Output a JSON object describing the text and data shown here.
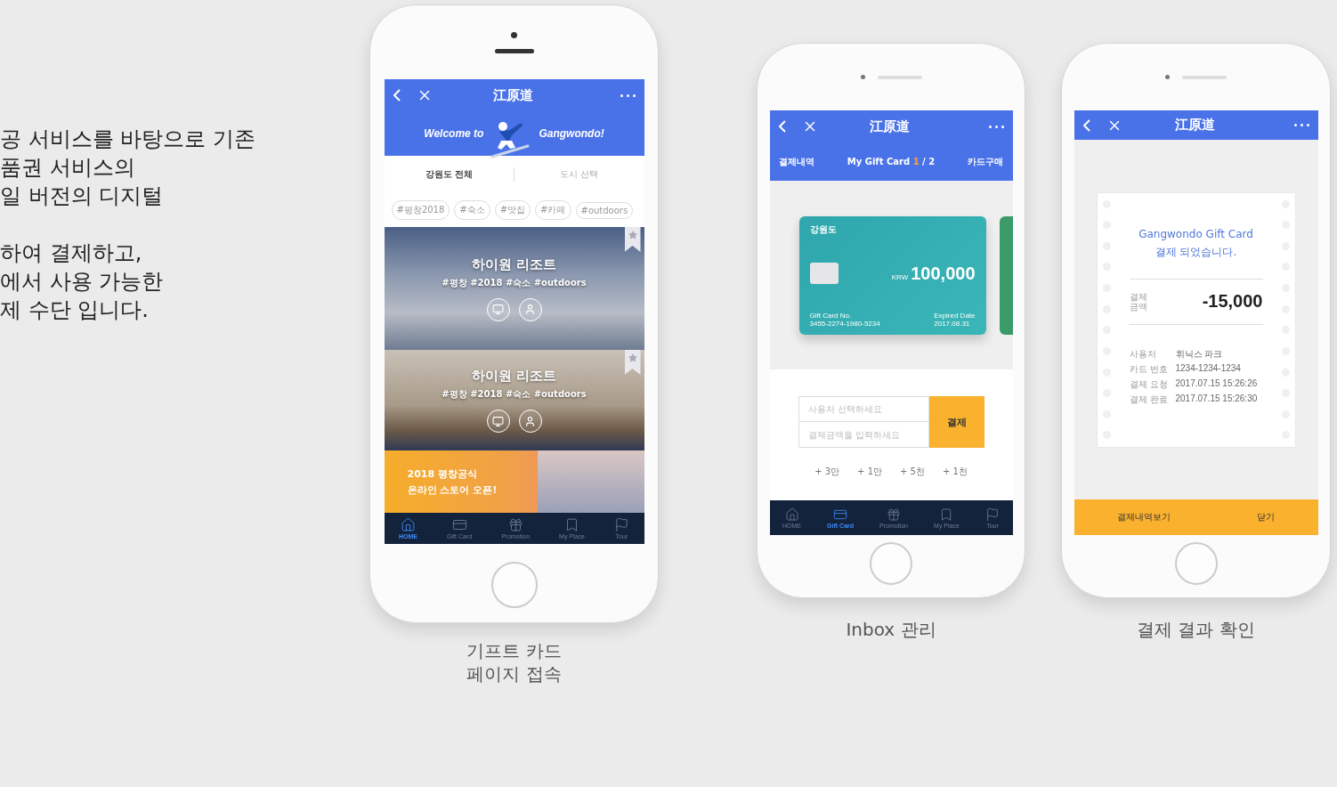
{
  "intro": {
    "paragraphs": [
      [
        "공 서비스를 바탕으로 기존",
        "품권 서비스의",
        "일 버전의 디지털"
      ],
      [
        "하여 결제하고,",
        "에서 사용 가능한",
        "제 수단 입니다."
      ]
    ]
  },
  "home_phone": {
    "title": "江原道",
    "welcome": [
      "Welcome to",
      "Gangwondo!"
    ],
    "tabs": [
      {
        "label": "강원도 전체",
        "selected": true
      },
      {
        "label": "도시 선택",
        "selected": false
      }
    ],
    "tags": [
      "#평창2018",
      "#숙소",
      "#맛집",
      "#카페",
      "#outdoors"
    ],
    "resorts": [
      {
        "name": "하이원 리조트",
        "tags": "#평창 #2018 #숙소 #outdoors",
        "kind": "snow"
      },
      {
        "name": "하이원 리조트",
        "tags": "#평창 #2018 #숙소 #outdoors",
        "kind": "room"
      }
    ],
    "promo": [
      "2018 평창공식",
      "온라인 스토어 오픈!"
    ],
    "nav": [
      {
        "label": "HOME",
        "kind": "home",
        "selected": true
      },
      {
        "label": "Gift Card",
        "kind": "card",
        "selected": false
      },
      {
        "label": "Promotion",
        "kind": "gift",
        "selected": false
      },
      {
        "label": "My Place",
        "kind": "bookmark",
        "selected": false
      },
      {
        "label": "Tour",
        "kind": "flag",
        "selected": false
      }
    ],
    "caption": [
      "기프트 카드",
      "페이지 접속"
    ]
  },
  "inbox_phone": {
    "title": "江原道",
    "subtabs": [
      {
        "label": "결제내역",
        "kind": "plain"
      },
      {
        "label": "My Gift Card",
        "current": "1",
        "total": "/ 2",
        "kind": "pager"
      },
      {
        "label": "카드구매",
        "kind": "plain"
      }
    ],
    "card": {
      "brand": "강원도",
      "currency": "KRW",
      "amount": "100,000",
      "number_label": "Gift Card No.",
      "number": "3455-2274-1980-5234",
      "expiry_label": "Expired Date",
      "expiry": "2017.08.31"
    },
    "form": {
      "place_placeholder": "사용처 선택하세요",
      "amount_placeholder": "결제금액을 입력하세요",
      "button": "결제"
    },
    "quick_amounts": [
      "+ 3만",
      "+ 1만",
      "+ 5천",
      "+ 1천"
    ],
    "nav": [
      {
        "label": "HOME",
        "kind": "home",
        "selected": false
      },
      {
        "label": "Gift Card",
        "kind": "card",
        "selected": true
      },
      {
        "label": "Promotion",
        "kind": "gift",
        "selected": false
      },
      {
        "label": "My Place",
        "kind": "bookmark",
        "selected": false
      },
      {
        "label": "Tour",
        "kind": "flag",
        "selected": false
      }
    ],
    "caption": "Inbox 관리"
  },
  "receipt_phone": {
    "title": "江原道",
    "heading": [
      "Gangwondo Gift Card",
      "결제 되었습니다."
    ],
    "amount_label": "결제\n금액",
    "amount": "-15,000",
    "details": [
      {
        "label": "사용처",
        "value": "휘닉스 파크"
      },
      {
        "label": "카드 번호",
        "value": "1234-1234-1234"
      },
      {
        "label": "결제 요청",
        "value": "2017.07.15 15:26:26"
      },
      {
        "label": "결제 완료",
        "value": "2017.07.15 15:26:30"
      }
    ],
    "actions": [
      "결제내역보기",
      "닫기"
    ],
    "caption": "결제 결과 확인"
  }
}
